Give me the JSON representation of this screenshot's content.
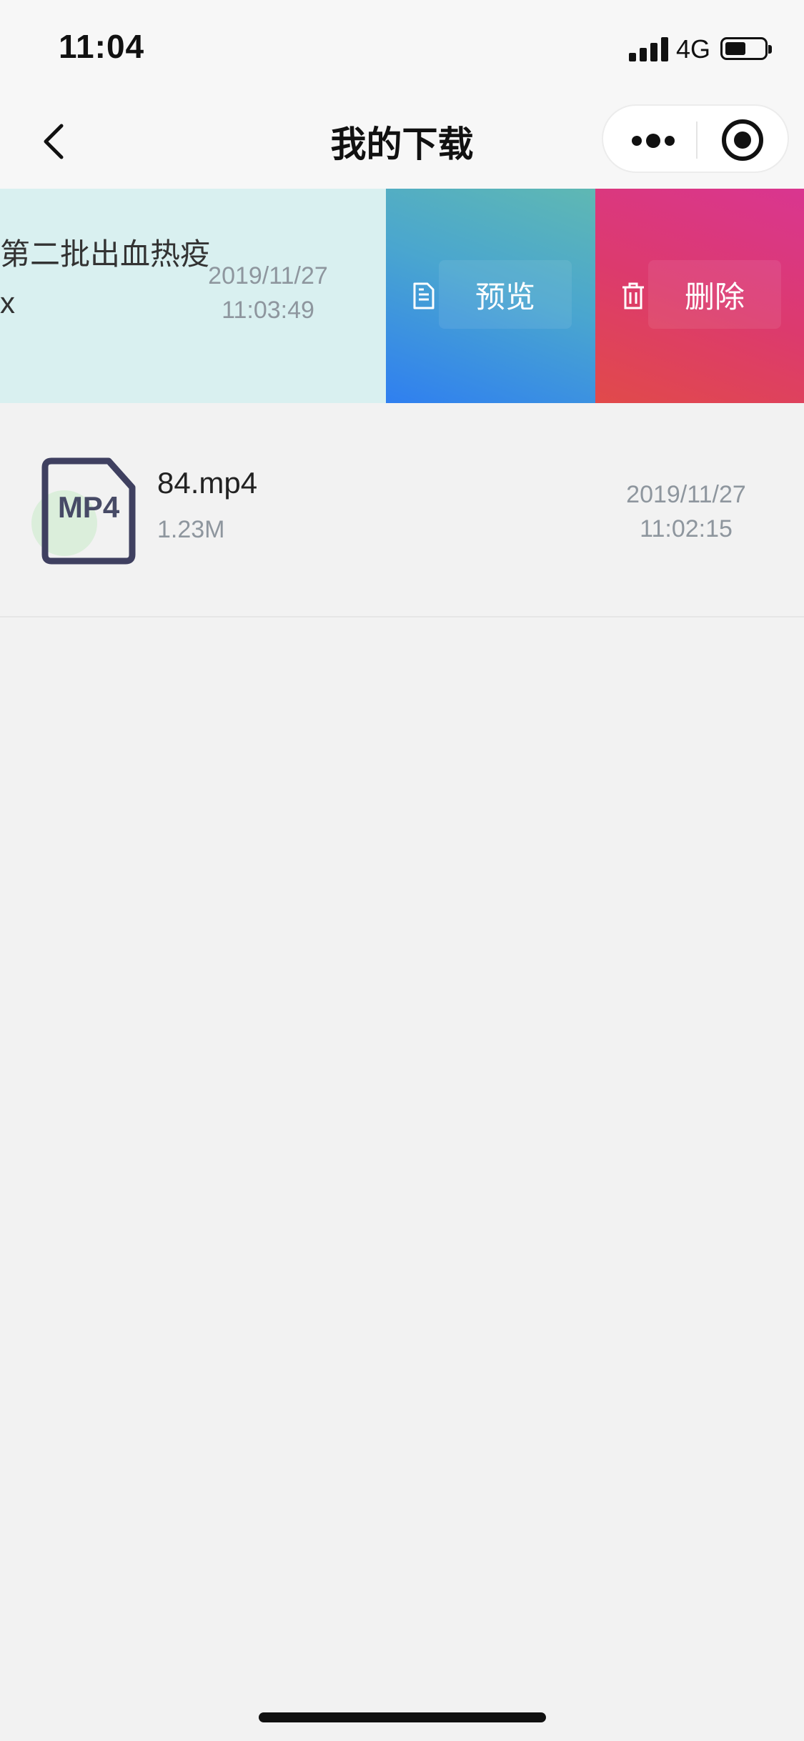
{
  "status_bar": {
    "time": "11:04",
    "network": "4G",
    "battery_level": 0.5
  },
  "nav": {
    "title": "我的下载",
    "back_icon": "chevron-left-icon",
    "more_icon": "more-dots-icon",
    "close_icon": "target-close-icon"
  },
  "downloads": [
    {
      "name_line1": "第二批出血热疫",
      "name_line2": "x",
      "date": "2019/11/27",
      "time": "11:03:49",
      "swiped_open": true,
      "actions": [
        {
          "label": "预览",
          "icon": "document-icon",
          "color": "#3a8ee6"
        },
        {
          "label": "删除",
          "icon": "trash-icon",
          "color": "#dc3a6e"
        }
      ]
    },
    {
      "type_label": "MP4",
      "name": "84.mp4",
      "size": "1.23M",
      "date": "2019/11/27",
      "time": "11:02:15"
    }
  ]
}
